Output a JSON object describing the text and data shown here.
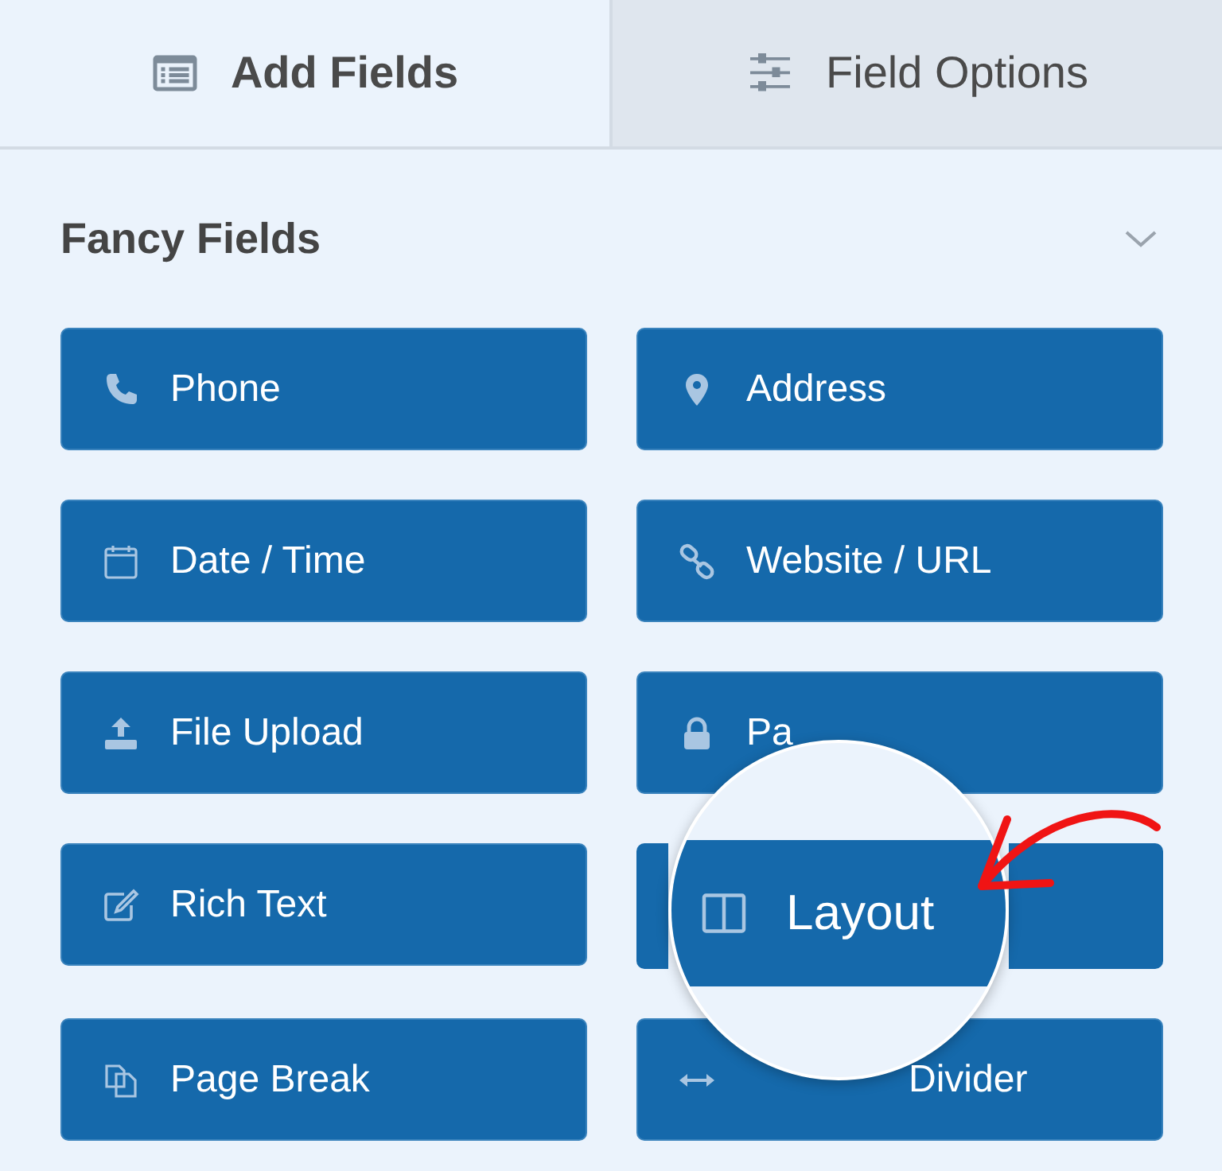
{
  "tabs": [
    {
      "label": "Add Fields",
      "selected": true
    },
    {
      "label": "Field Options",
      "selected": false
    }
  ],
  "section": {
    "title": "Fancy Fields",
    "expanded": true
  },
  "fields": [
    {
      "label": "Phone",
      "magnified": false
    },
    {
      "label": "Address",
      "magnified": false
    },
    {
      "label": "Date / Time",
      "magnified": false
    },
    {
      "label": "Website / URL",
      "magnified": false
    },
    {
      "label": "File Upload",
      "magnified": false
    },
    {
      "label": "Pa",
      "magnified": false
    },
    {
      "label": "Rich Text",
      "magnified": false
    },
    {
      "label": "Layout",
      "magnified": true
    },
    {
      "label": "Page Break",
      "magnified": false
    },
    {
      "label": "Divider",
      "magnified": false
    }
  ]
}
